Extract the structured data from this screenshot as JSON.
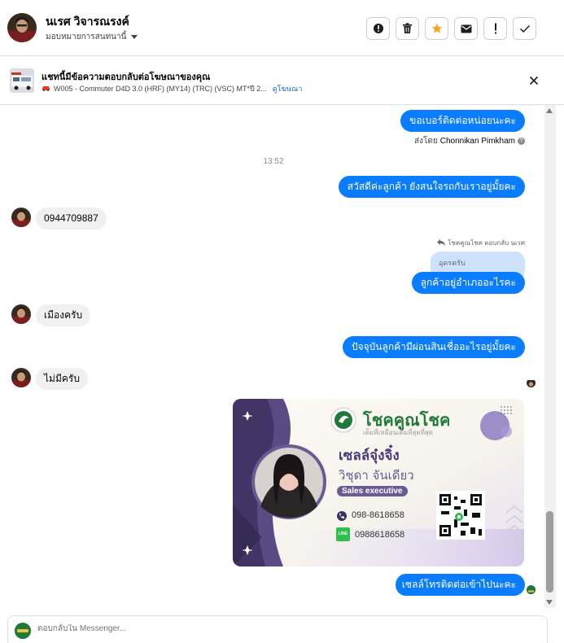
{
  "header": {
    "contact_name": "นเรศ วิจารณรงค์",
    "assign_label": "มอบหมายการสนทนานี้",
    "icons": [
      "alert-circle-icon",
      "trash-icon",
      "star-icon",
      "mail-icon",
      "exclamation-icon",
      "check-icon"
    ]
  },
  "ad": {
    "title": "แชทนี้มีข้อความตอบกลับต่อโฆษณาของคุณ",
    "subtitle": "W005 - Commuter D4D 3.0 (HRF) (MY14) (TRC) (VSC) MT*ปี 2...",
    "link": "ดูโฆษณา"
  },
  "messages": {
    "m1": "ขอเบอร์ติดต่อหน่อยนะคะ",
    "sent_by_prefix": "ส่งโดย",
    "sent_by_name": "Chonnikan Pimkham",
    "timestamp": "13:52",
    "m2": "สวัสดีค่ะลูกค้า ยังสนใจรถกับเราอยู่มั้ยคะ",
    "m3": "0944709887",
    "reply_meta": "โชคคูณโชค ตอบกลับ นเรศ",
    "quote": "อุดรครับ",
    "m4": "ลูกค้าอยู่อำเภออะไรคะ",
    "m5": "เมืองครับ",
    "m6": "ปัจจุบันลูกค้ามีผ่อนสินเชื่ออะไรอยู่มั้ยคะ",
    "m7": "ไม่มีครับ",
    "m8": "เซลล์โทรติดต่อเข้าไปนะคะ"
  },
  "card": {
    "brand": "โชคคูณโชค",
    "tagline": "เต็มที่เหมือนเดิมที่สุดที่สุด",
    "title": "เซลล์จุ๋งจิ๋ง",
    "name": "วิชุดา จันเดียว",
    "role": "Sales executive",
    "phone": "098-8618658",
    "line": "0988618658",
    "line_badge": "LINE"
  },
  "composer": {
    "placeholder": "ตอบกลับใน Messenger..."
  },
  "colors": {
    "outgoing": "#0a7cff",
    "incoming": "#f0f0f0",
    "card_purple": "#6b5b95",
    "brand_green": "#1f7a3a"
  }
}
